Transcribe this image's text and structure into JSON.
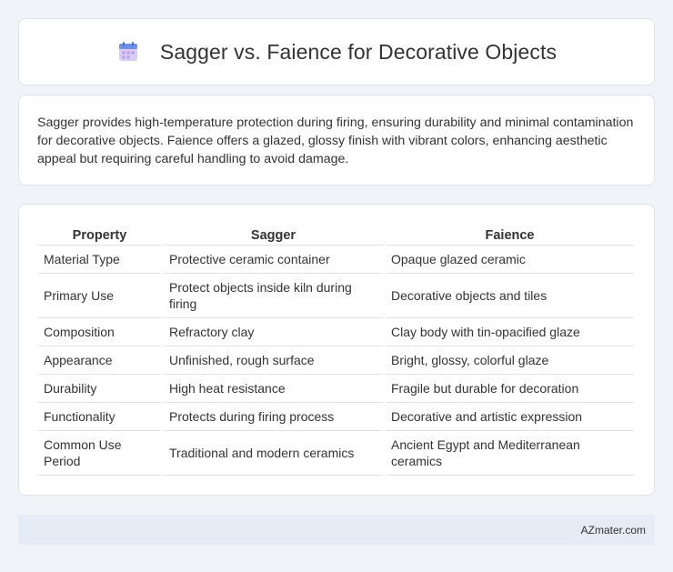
{
  "header": {
    "title": "Sagger vs. Faience for Decorative Objects",
    "icon": "calendar-icon"
  },
  "intro": {
    "text": "Sagger provides high-temperature protection during firing, ensuring durability and minimal contamination for decorative objects. Faience offers a glazed, glossy finish with vibrant colors, enhancing aesthetic appeal but requiring careful handling to avoid damage."
  },
  "table": {
    "headers": [
      "Property",
      "Sagger",
      "Faience"
    ],
    "rows": [
      [
        "Material Type",
        "Protective ceramic container",
        "Opaque glazed ceramic"
      ],
      [
        "Primary Use",
        "Protect objects inside kiln during firing",
        "Decorative objects and tiles"
      ],
      [
        "Composition",
        "Refractory clay",
        "Clay body with tin-opacified glaze"
      ],
      [
        "Appearance",
        "Unfinished, rough surface",
        "Bright, glossy, colorful glaze"
      ],
      [
        "Durability",
        "High heat resistance",
        "Fragile but durable for decoration"
      ],
      [
        "Functionality",
        "Protects during firing process",
        "Decorative and artistic expression"
      ],
      [
        "Common Use Period",
        "Traditional and modern ceramics",
        "Ancient Egypt and Mediterranean ceramics"
      ]
    ]
  },
  "footer": {
    "brand": "AZmater.com"
  },
  "colors": {
    "background": "#f0f3f8",
    "card": "#ffffff",
    "footer": "#e6ecf6",
    "icon_top": "#6f8fe8",
    "icon_body": "#c9b8f0"
  }
}
